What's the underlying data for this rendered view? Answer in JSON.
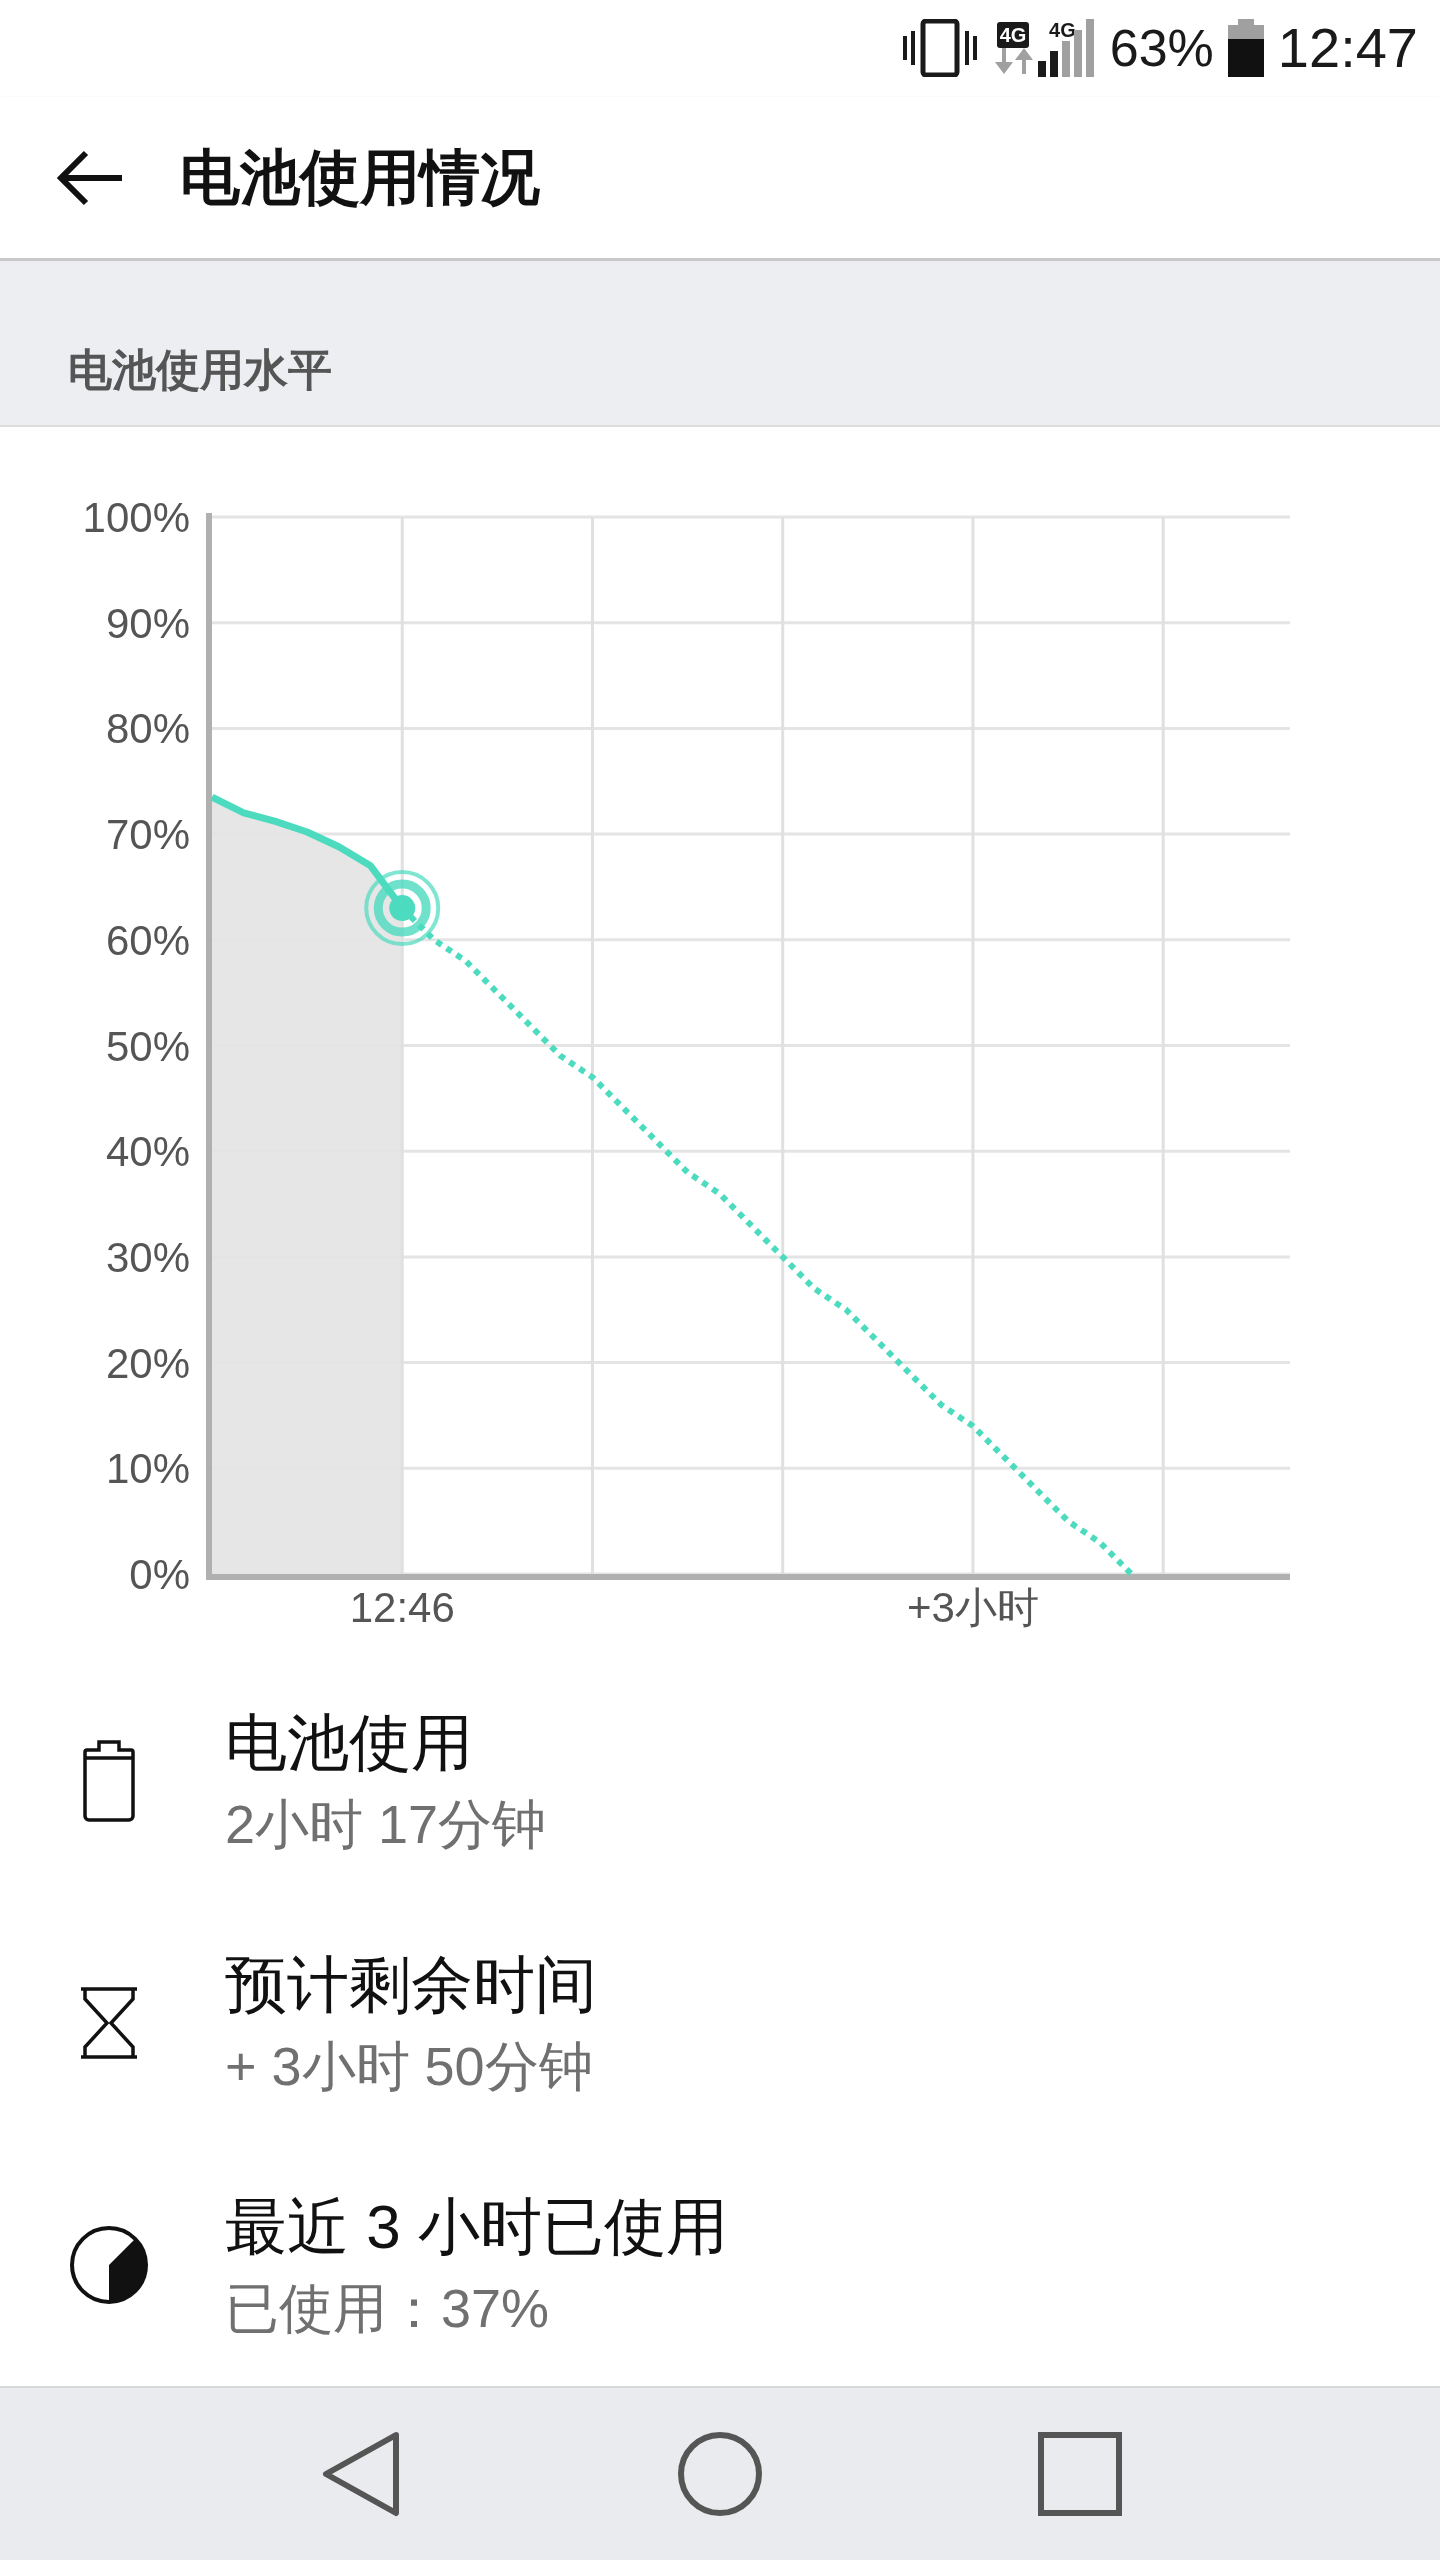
{
  "status_bar": {
    "data_badge": "4G",
    "signal_label": "4G",
    "battery_percent": "63%",
    "time": "12:47"
  },
  "app_bar": {
    "title": "电池使用情况"
  },
  "section": {
    "title": "电池使用水平"
  },
  "chart": {
    "chart_data": {
      "type": "line",
      "categories": [
        null,
        null,
        null,
        null,
        null,
        null,
        "12:46",
        null,
        null,
        null,
        null,
        null,
        null,
        null,
        null,
        null,
        null,
        null,
        null,
        null,
        null,
        null,
        null,
        null,
        "+3小时",
        null,
        null,
        null,
        null,
        null,
        null,
        null,
        null,
        null,
        null
      ],
      "grid": true,
      "series": [
        {
          "color": "#4cdbbe",
          "line_style": "solid",
          "values": [
            73.5,
            72,
            71.2,
            70.2,
            68.8,
            67,
            63,
            null,
            null,
            null,
            null,
            null,
            null,
            null,
            null,
            null,
            null,
            null,
            null,
            null,
            null,
            null,
            null,
            null,
            null,
            null,
            null,
            null,
            null,
            null,
            null,
            null,
            null,
            null,
            null
          ]
        },
        {
          "color": "#4cdbbe",
          "line_style": "dotted",
          "values": [
            null,
            null,
            null,
            null,
            null,
            null,
            63,
            60,
            58,
            55,
            52,
            49,
            47,
            44,
            41,
            38,
            36,
            33,
            30,
            27,
            25,
            22,
            19,
            16,
            14,
            11,
            8,
            5,
            3,
            0,
            null,
            null,
            null,
            null,
            null
          ]
        }
      ],
      "ylim": [
        0,
        100
      ],
      "yticks": [
        {
          "value": 0,
          "label": "0%"
        },
        {
          "value": 10,
          "label": "10%"
        },
        {
          "value": 20,
          "label": "20%"
        },
        {
          "value": 30,
          "label": "30%"
        },
        {
          "value": 40,
          "label": "40%"
        },
        {
          "value": 50,
          "label": "50%"
        },
        {
          "value": 60,
          "label": "60%"
        },
        {
          "value": 70,
          "label": "70%"
        },
        {
          "value": 80,
          "label": "80%"
        },
        {
          "value": 90,
          "label": "90%"
        },
        {
          "value": 100,
          "label": "100%"
        }
      ]
    }
  },
  "items": [
    {
      "kind": "battery",
      "title": "电池使用",
      "detail": "2小时 17分钟"
    },
    {
      "kind": "hourglass",
      "title": "预计剩余时间",
      "detail": "+ 3小时 50分钟"
    },
    {
      "kind": "pie",
      "title": "最近 3 小时已使用",
      "detail": "已使用：37%"
    }
  ]
}
